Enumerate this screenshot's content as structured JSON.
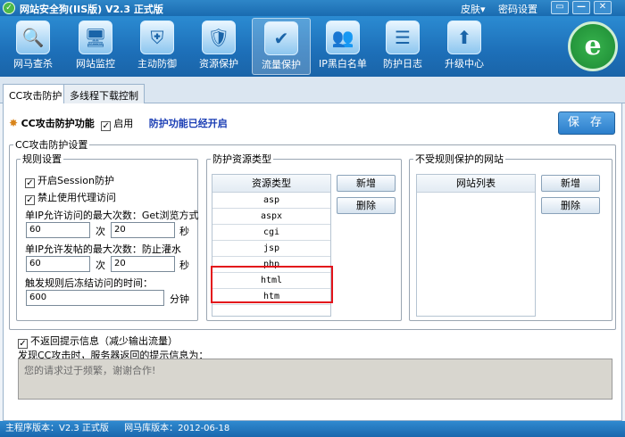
{
  "app": {
    "title": "网站安全狗(IIS版) V2.3 正式版",
    "menu_skin": "皮肤▾",
    "menu_password": "密码设置",
    "logo_letter": "e"
  },
  "toolbar": [
    {
      "label": "网马查杀",
      "icon": "trojan-scan-icon",
      "glyph": "🔍"
    },
    {
      "label": "网站监控",
      "icon": "monitor-icon",
      "glyph": "🖥"
    },
    {
      "label": "主动防御",
      "icon": "defense-icon",
      "glyph": "⛨"
    },
    {
      "label": "资源保护",
      "icon": "resource-protect-icon",
      "glyph": "🛡"
    },
    {
      "label": "流量保护",
      "icon": "traffic-protect-icon",
      "glyph": "✔"
    },
    {
      "label": "IP黑白名单",
      "icon": "ip-list-icon",
      "glyph": "👥"
    },
    {
      "label": "防护日志",
      "icon": "log-icon",
      "glyph": "☰"
    },
    {
      "label": "升级中心",
      "icon": "upgrade-icon",
      "glyph": "⬆"
    }
  ],
  "tabs": [
    "CC攻击防护",
    "多线程下载控制"
  ],
  "cc": {
    "feature_label": "CC攻击防护功能",
    "enable_label": "启用",
    "status": "防护功能已经开启",
    "save": "保 存",
    "settings_legend": "CC攻击防护设置"
  },
  "rules": {
    "legend": "规则设置",
    "session_label": "开启Session防护",
    "proxy_label": "禁止使用代理访问",
    "visit_label": "单IP允许访问的最大次数：Get浏览方式",
    "visit_count": "60",
    "visit_count_unit": "次",
    "visit_seconds": "20",
    "visit_seconds_unit": "秒",
    "post_label": "单IP允许发帖的最大次数：防止灌水",
    "post_count": "60",
    "post_count_unit": "次",
    "post_seconds": "20",
    "post_seconds_unit": "秒",
    "freeze_label": "触发规则后冻结访问的时间：",
    "freeze_value": "600",
    "freeze_unit": "分钟"
  },
  "resources": {
    "legend": "防护资源类型",
    "header": "资源类型",
    "items": [
      "asp",
      "aspx",
      "cgi",
      "jsp",
      "php",
      "html",
      "htm"
    ],
    "add": "新增",
    "delete": "删除"
  },
  "exempt": {
    "legend": "不受规则保护的网站",
    "header": "网站列表",
    "add": "新增",
    "delete": "删除"
  },
  "notify": {
    "no_return_label": "不返回提示信息（减少输出流量）",
    "found_label": "发现CC攻击时，服务器返回的提示信息为：",
    "message": "您的请求过于频繁，谢谢合作!"
  },
  "status": {
    "main_version": "主程序版本：V2.3 正式版",
    "db_version": "网马库版本：2012-06-18"
  }
}
